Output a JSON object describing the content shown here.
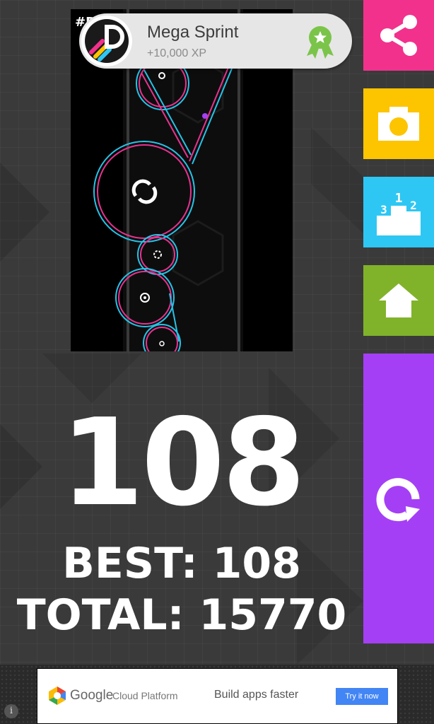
{
  "achievement": {
    "title": "Mega Sprint",
    "xp": "+10,000 XP"
  },
  "score": {
    "current": "108",
    "best": "BEST: 108",
    "total": "TOTAL: 15770"
  },
  "buttons": [
    {
      "name": "share",
      "icon": "share-icon",
      "color": "#f2318d"
    },
    {
      "name": "camera",
      "icon": "camera-icon",
      "color": "#fdc400"
    },
    {
      "name": "leaderboard",
      "icon": "podium-icon",
      "color": "#2ec7f3"
    },
    {
      "name": "home",
      "icon": "home-icon",
      "color": "#80b32a"
    },
    {
      "name": "replay",
      "icon": "replay-icon",
      "color": "#a53ff5"
    }
  ],
  "leaderboard_icon": {
    "first": "1",
    "second": "2",
    "third": "3"
  },
  "screenshot_overlay": "#D",
  "ad": {
    "brand": "Google",
    "product": "Cloud Platform",
    "tagline": "Build apps faster",
    "cta": "Try it now"
  },
  "info": "i"
}
